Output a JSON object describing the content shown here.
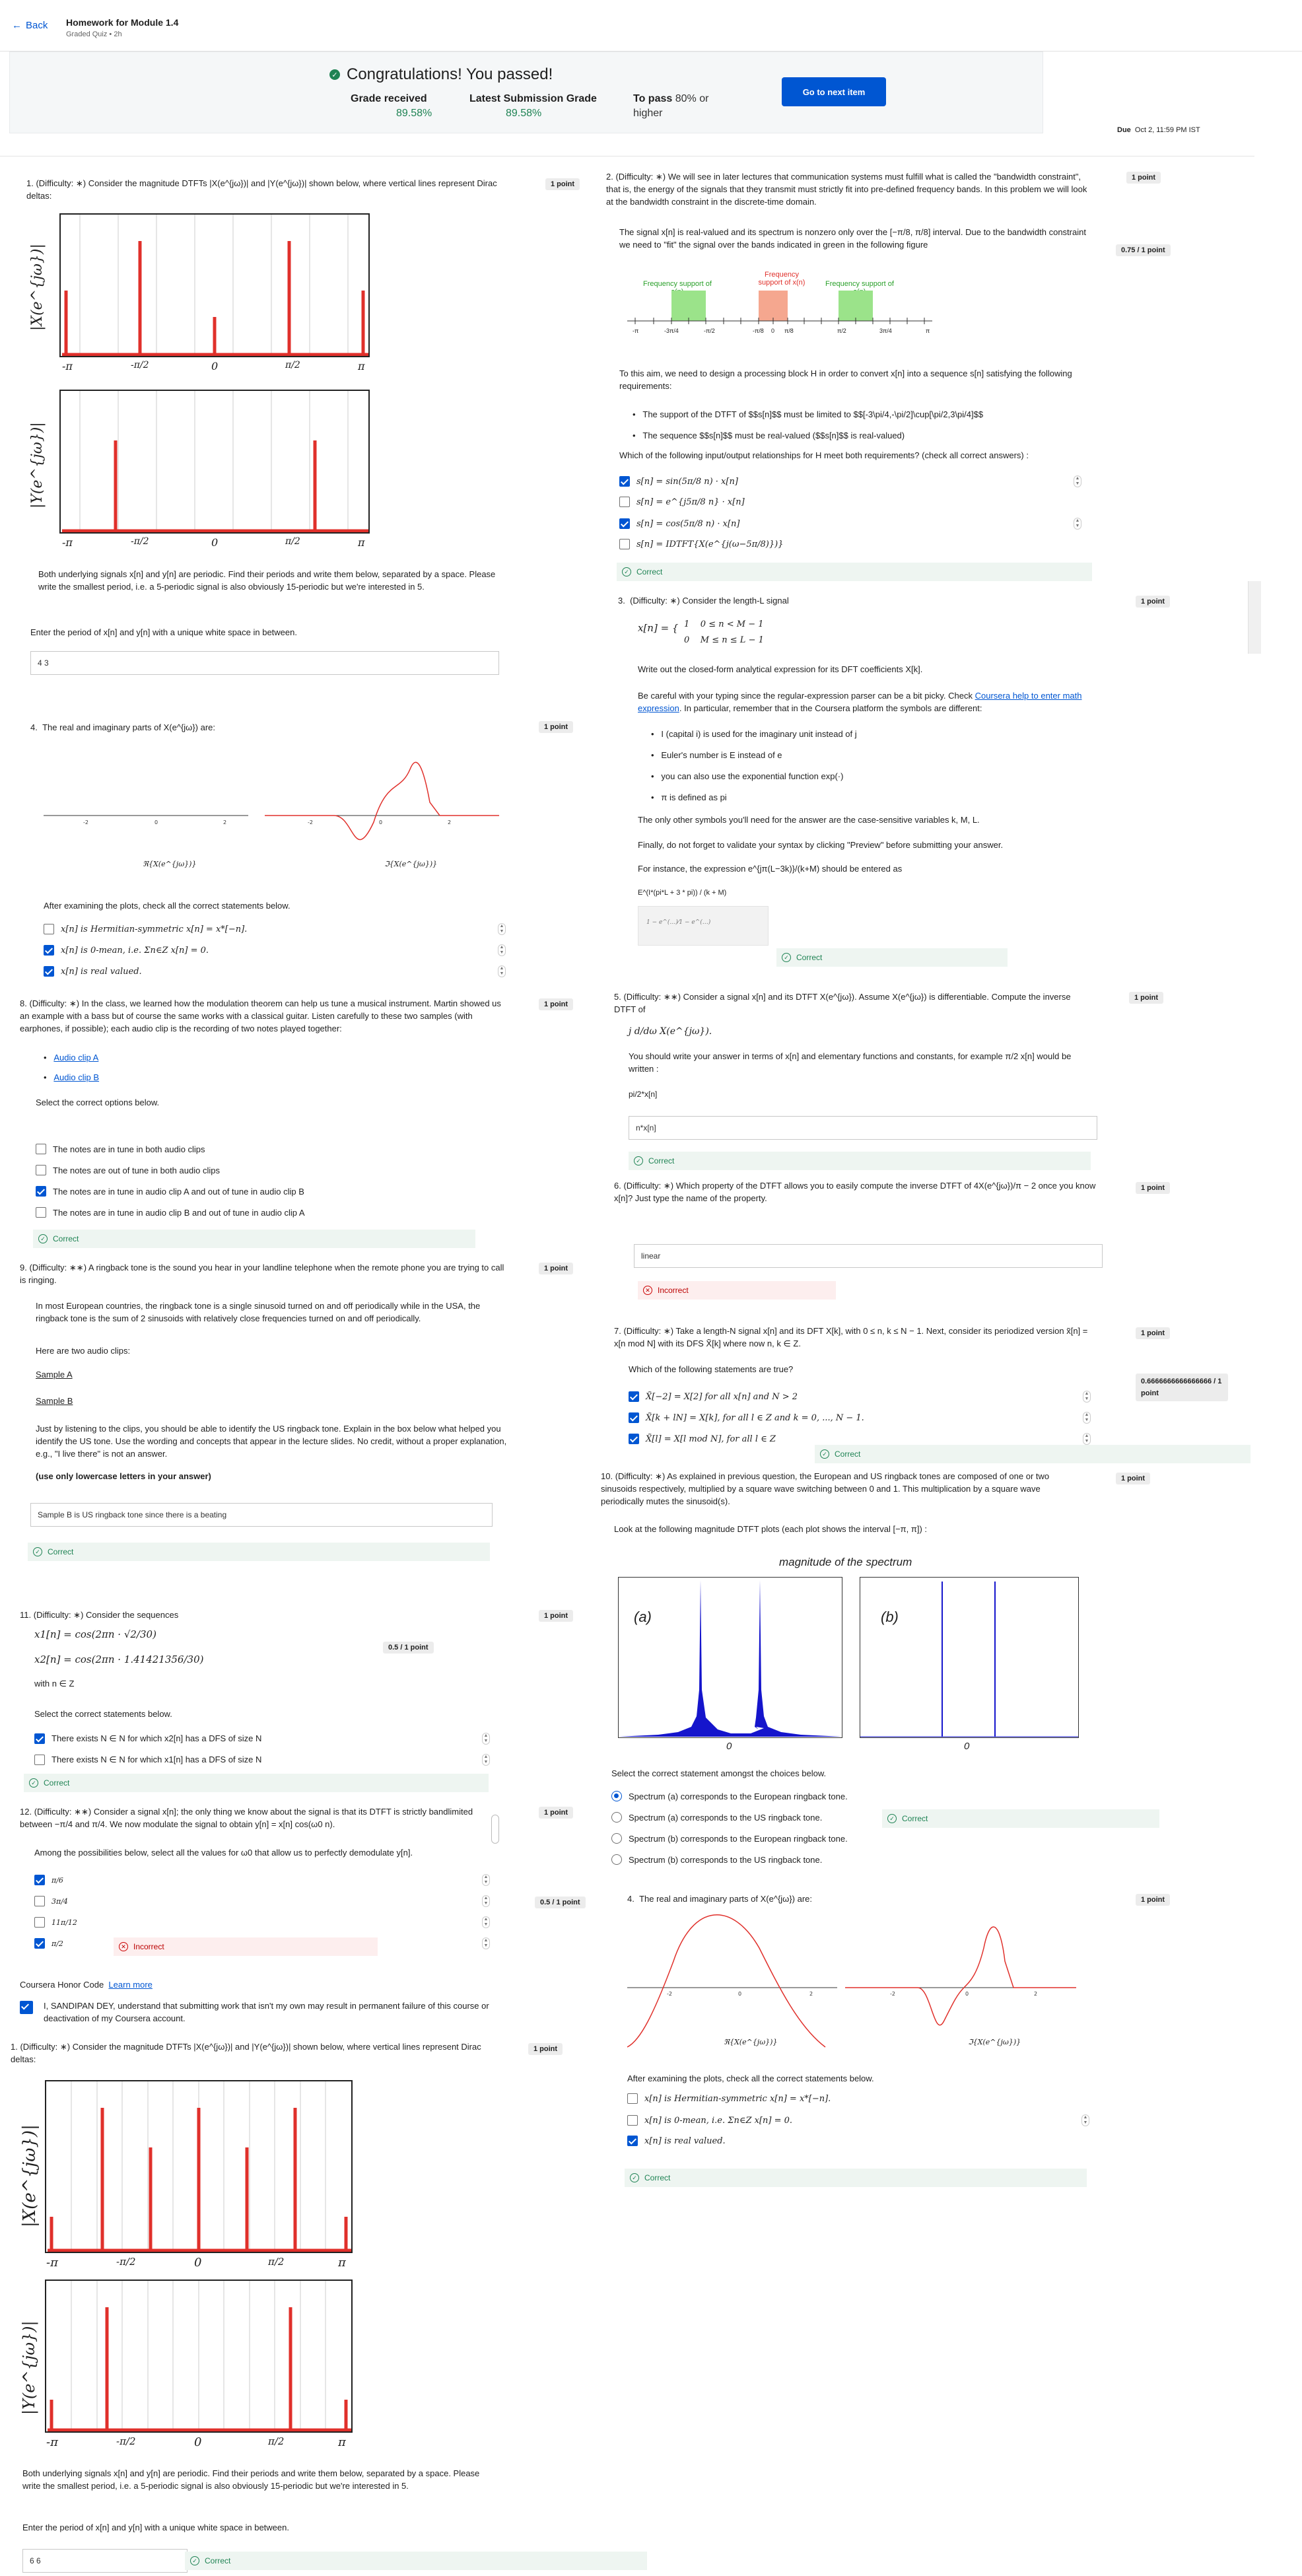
{
  "header": {
    "back": "Back",
    "title": "Homework for Module 1.4",
    "subtitle": "Graded Quiz • 2h"
  },
  "banner": {
    "congrats": "Congratulations! You passed!",
    "grade_label": "Grade received",
    "grade_value": "89.58%",
    "latest_label": "Latest Submission Grade",
    "latest_value": "89.58%",
    "pass_label": "To pass",
    "pass_value": "80% or higher",
    "next_button": "Go to next item"
  },
  "due": {
    "label": "Due",
    "date": "Oct 2, 11:59 PM IST"
  },
  "q1": {
    "num": "1.",
    "text": "(Difficulty: ∗) Consider the magnitude DTFTs |X(e^{jω})| and |Y(e^{jω})| shown below, where vertical lines represent Dirac deltas:",
    "points": "1 point",
    "ylabel_x": "|X(e^{jω})|",
    "ylabel_y": "|Y(e^{jω})|",
    "ticks": [
      "-π",
      "-π/2",
      "0",
      "π/2",
      "π"
    ],
    "body": "Both underlying signals x[n] and y[n] are periodic. Find their periods and write them below, separated by a space. Please write the smallest period, i.e. a 5-periodic signal is also obviously 15-periodic but we're interested in 5.",
    "prompt": "Enter the period of x[n] and y[n] with a unique white space in between.",
    "answer": "4 3"
  },
  "q4": {
    "num": "4.",
    "text": "The real and imaginary parts of X(e^{jω}) are:",
    "points": "1 point",
    "label_re": "ℜ{X(e^{jω})}",
    "label_im": "ℑ{X(e^{jω})}",
    "prompt": "After examining the plots, check all the correct statements below.",
    "options": [
      "x[n] is Hermitian-symmetric x[n] = x*[−n].",
      "x[n] is 0-mean, i.e. Σn∈Z x[n] = 0.",
      "x[n] is real valued."
    ]
  },
  "q8": {
    "num": "8.",
    "text": "(Difficulty: ∗) In the class, we learned how the modulation theorem can help us tune a musical instrument. Martin showed us an example with a bass but of course the same works with a classical guitar. Listen carefully to these two samples (with earphones, if possible); each audio clip is the recording of two notes played together:",
    "points": "1 point",
    "links": [
      "Audio clip A",
      "Audio clip B"
    ],
    "prompt": "Select the correct options below.",
    "options": [
      "The notes are in tune in both audio clips",
      "The notes are out of tune in both audio clips",
      "The notes are in tune in audio clip A and out of tune in audio clip B",
      "The notes are in tune in audio clip B and out of tune in audio clip A"
    ],
    "feedback": "Correct"
  },
  "q9": {
    "num": "9.",
    "text": "(Difficulty: ∗∗) A ringback tone is the sound you hear in your landline telephone when the remote phone you are trying to call is ringing.",
    "points": "1 point",
    "p2": "In most European countries, the ringback tone is a single sinusoid turned on and off periodically while in the USA, the ringback tone is the sum of 2 sinusoids with relatively close frequencies turned on and off periodically.",
    "p3": "Here are two audio clips:",
    "links": [
      "Sample A",
      "Sample B"
    ],
    "p4": "Just by listening to the clips, you should be able to identify the US ringback tone. Explain in the box below what helped you identify the US tone. Use the wording and concepts that appear in the lecture slides. No credit, without a proper explanation, e.g., \"I live there\" is not an answer.",
    "p5": "(use only lowercase letters in your answer)",
    "answer": "Sample B is US ringback tone since there is a beating",
    "feedback": "Correct"
  },
  "q11": {
    "num": "11.",
    "text": "(Difficulty: ∗) Consider the sequences",
    "points": "1 point",
    "score": "0.5 / 1 point",
    "eq1": "x1[n] = cos(2πn · √2/30)",
    "eq2": "x2[n] = cos(2πn · 1.41421356/30)",
    "with": "with n ∈ Z",
    "prompt": "Select the correct statements below.",
    "options": [
      "There exists N ∈ N for which x2[n] has a DFS of size N",
      "There exists N ∈ N for which x1[n] has a DFS of size N"
    ],
    "feedback": "Correct"
  },
  "q12": {
    "num": "12.",
    "text": "(Difficulty: ∗∗) Consider a signal x[n]; the only thing we know about the signal is that its DTFT is strictly bandlimited between −π/4 and π/4. We now modulate the signal to obtain y[n] = x[n] cos(ω0 n).",
    "points": "1 point",
    "score": "0.5 / 1 point",
    "prompt": "Among the possibilities below, select all the values for ω0 that allow us to perfectly demodulate y[n].",
    "options": [
      "π/6",
      "3π/4",
      "11π/12",
      "π/2"
    ],
    "feedback": "Incorrect"
  },
  "honor": {
    "title": "Coursera Honor Code",
    "learn": "Learn more",
    "text": "I, SANDIPAN DEY, understand that submitting work that isn't my own may result in permanent failure of this course or deactivation of my Coursera account."
  },
  "q1b": {
    "num": "1.",
    "text": "(Difficulty: ∗) Consider the magnitude DTFTs |X(e^{jω})| and |Y(e^{jω})| shown below, where vertical lines represent Dirac deltas:",
    "points": "1 point",
    "body": "Both underlying signals x[n] and y[n] are periodic. Find their periods and write them below, separated by a space. Please write the smallest period, i.e. a 5-periodic signal is also obviously 15-periodic but we're interested in 5.",
    "prompt": "Enter the period of x[n] and y[n] with a unique white space in between.",
    "answer": "6 6",
    "feedback": "Correct"
  },
  "q2": {
    "num": "2.",
    "text": "(Difficulty: ∗) We will see in later lectures that communication systems must fulfill what is called the \"bandwidth constraint\", that is, the energy of the signals that they transmit must strictly fit into pre-defined frequency bands. In this problem we will look at the bandwidth constraint in the discrete-time domain.",
    "points": "1 point",
    "score": "0.75 / 1 point",
    "p2": "The signal x[n] is real-valued and its spectrum is nonzero only over the [−π/8, π/8] interval. Due to the bandwidth constraint we need to \"fit\" the signal over the bands indicated in green in the following figure",
    "band_left": "Frequency support of s(n)",
    "band_mid": "Frequency support of x(n)",
    "band_right": "Frequency support of s(n)",
    "axis": [
      "-π",
      "-3π/4",
      "-π/2",
      "-π/8",
      "0",
      "π/8",
      "π/2",
      "3π/4",
      "π"
    ],
    "p3": "To this aim, we need to design a processing block H in order to convert x[n] into a sequence s[n] satisfying the following requirements:",
    "bullets": [
      "The support of the DTFT of $$s[n]$$ must be limited to $$[-3\\pi/4,-\\pi/2]\\cup[\\pi/2,3\\pi/4]$$",
      "The sequence $$s[n]$$ must be real-valued ($$s[n]$$ is real-valued)"
    ],
    "prompt": "Which of the following input/output relationships for H meet both requirements? (check all correct answers) :",
    "options": [
      "s[n] = sin(5π/8 n) · x[n]",
      "s[n] = e^{j5π/8 n} · x[n]",
      "s[n] = cos(5π/8 n) · x[n]",
      "s[n] = IDTFT{X(e^{j(ω−5π/8)})}"
    ],
    "feedback": "Correct"
  },
  "q3": {
    "num": "3.",
    "text": "(Difficulty: ∗) Consider the length-L signal",
    "points": "1 point",
    "case1": "1    0 ≤ n < M − 1",
    "case2": "0    M ≤ n ≤ L − 1",
    "p2": "Write out the closed-form analytical expression for its DFT coefficients X[k].",
    "p3a": "Be careful with your typing since the regular-expression parser can be a bit picky. Check ",
    "p3link": "Coursera help to enter math expression",
    "p3b": ". In particular, remember that in the Coursera platform the symbols are different:",
    "bullets": [
      "I (capital i) is used for the imaginary unit instead of j",
      "Euler's number is E instead of e",
      "you can also use the exponential function exp(·)",
      "π is defined as pi"
    ],
    "p4": "The only other symbols you'll need for the answer are the case-sensitive variables k, M, L.",
    "p5": "Finally, do not forget to validate your syntax by clicking \"Preview\" before submitting your answer.",
    "p6": "For instance, the expression e^{jπ(L−3k)}/(k+M) should be entered as",
    "example": "E^(I*(pi*L + 3 * pi)) / (k + M)",
    "feedback": "Correct"
  },
  "q5": {
    "num": "5.",
    "text": "(Difficulty: ∗∗) Consider a signal x[n] and its DTFT X(e^{jω}). Assume X(e^{jω}) is differentiable. Compute the inverse DTFT of",
    "expr": "j d/dω X(e^{jω}).",
    "p2": "You should write your answer in terms of x[n] and elementary functions and constants, for example π/2 x[n] would be written :",
    "example": "pi/2*x[n]",
    "points": "1 point",
    "answer": "n*x[n]",
    "feedback": "Correct"
  },
  "q6": {
    "num": "6.",
    "text": "(Difficulty: ∗) Which property of the DTFT allows you to easily compute the inverse DTFT of 4X(e^{jω})/π − 2 once you know x[n]? Just type the name of the property.",
    "points": "1 point",
    "answer": "linear",
    "feedback": "Incorrect"
  },
  "q7": {
    "num": "7.",
    "text": "(Difficulty: ∗) Take a length-N signal x[n] and its DFT X[k], with 0 ≤ n, k ≤ N − 1. Next, consider its periodized version x̃[n] = x[n mod N] with its DFS X̃[k] where now n, k ∈ Z.",
    "points": "1 point",
    "score": "0.6666666666666666 / 1 point",
    "prompt": "Which of the following statements are true?",
    "options": [
      "X̃[−2] = X[2] for all x[n] and N > 2",
      "X̃[k + lN] = X[k], for all l ∈ Z and k = 0, ..., N − 1.",
      "X̃[l] = X[l mod N], for all l ∈ Z"
    ],
    "feedback": "Correct"
  },
  "q10": {
    "num": "10.",
    "text": "(Difficulty: ∗) As explained in previous question, the European and US ringback tones are composed of one or two sinusoids respectively, multiplied by a square wave switching between 0 and 1. This multiplication by a square wave periodically mutes the sinusoid(s).",
    "points": "1 point",
    "p2": "Look at the following magnitude DTFT plots (each plot shows the interval [−π, π]) :",
    "chart_title": "magnitude of the spectrum",
    "label_a": "(a)",
    "label_b": "(b)",
    "zero": "0",
    "prompt": "Select the correct statement amongst the choices below.",
    "options": [
      "Spectrum (a) corresponds to the European ringback tone.",
      "Spectrum (a) corresponds to the US ringback tone.",
      "Spectrum (b) corresponds to the European ringback tone.",
      "Spectrum (b) corresponds to the US ringback tone."
    ],
    "feedback": "Correct"
  },
  "q4b": {
    "num": "4.",
    "text": "The real and imaginary parts of X(e^{jω}) are:",
    "points": "1 point",
    "label_re": "ℜ{X(e^{jω})}",
    "label_im": "ℑ{X(e^{jω})}",
    "prompt": "After examining the plots, check all the correct statements below.",
    "options": [
      "x[n] is Hermitian-symmetric x[n] = x*[−n].",
      "x[n] is 0-mean, i.e. Σn∈Z x[n] = 0.",
      "x[n] is real valued."
    ],
    "feedback": "Correct"
  },
  "colors": {
    "accent": "#0056d2",
    "success": "#1f8354",
    "error": "#cc0000",
    "plot_red": "#e0302b",
    "plot_blue": "#1515cc"
  }
}
